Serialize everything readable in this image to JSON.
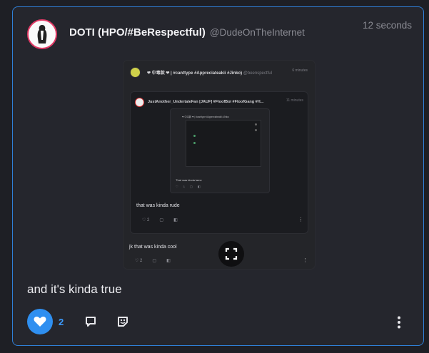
{
  "post": {
    "author_name": "DOTI (HPO/#BeRespectful)",
    "author_handle": "@DudeOnTheInternet",
    "time": "12 seconds",
    "text": "and it's kinda true",
    "like_count": "2"
  },
  "embed": {
    "title": "❤ 中毒款 ❤ | #canttype #Appreciateakii #Jinko)",
    "handle": "@beenspectful",
    "time": "6 minutes",
    "text": "jk that was kinda cool",
    "like_count": "2",
    "inner": {
      "title": "JustAnother_UndertaleFan [JAUF] #FloofBoi #FloofGang #H...",
      "time": "11 minutes",
      "text": "that was kinda rude",
      "like_count": "2",
      "inner2": {
        "title": "❤ 中毒款 ❤ | #canttype #Appreciateakii #Jinko",
        "text": "That was kinda lame",
        "like_count": "1"
      }
    }
  },
  "colors": {
    "accent": "#2f8ff0",
    "border": "#2f7fd6",
    "avatar_ring": "#e23a66"
  },
  "icons": [
    "heart-icon",
    "comment-icon",
    "sticker-icon",
    "more-vertical-icon",
    "expand-icon"
  ]
}
